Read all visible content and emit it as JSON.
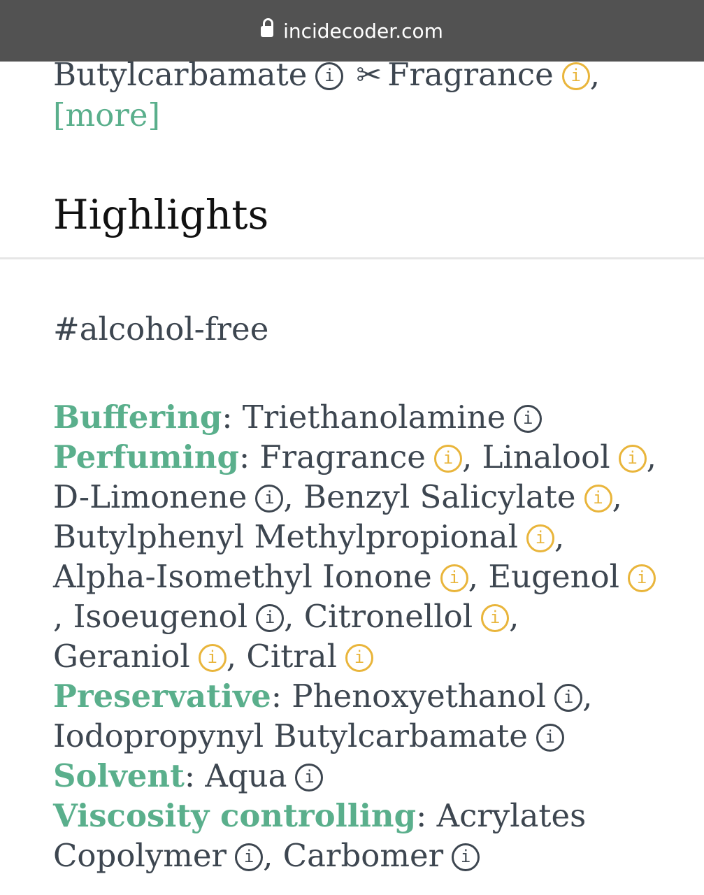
{
  "browser": {
    "url": "incidecoder.com"
  },
  "ingredients_tail": {
    "items": [
      {
        "name": "Butylcarbamate",
        "rating": "neutral"
      },
      {
        "name": "Fragrance",
        "rating": "warning"
      }
    ],
    "more_link": "[more]"
  },
  "highlights": {
    "title": "Highlights",
    "tag": "#alcohol-free"
  },
  "functions": [
    {
      "category": "Buffering",
      "ingredients": [
        {
          "name": "Triethanolamine",
          "rating": "neutral"
        }
      ]
    },
    {
      "category": "Perfuming",
      "ingredients": [
        {
          "name": "Fragrance",
          "rating": "warning"
        },
        {
          "name": "Linalool",
          "rating": "warning"
        },
        {
          "name": "D-Limonene",
          "rating": "neutral"
        },
        {
          "name": "Benzyl Salicylate",
          "rating": "warning"
        },
        {
          "name": "Butylphenyl Methylpropional",
          "rating": "warning"
        },
        {
          "name": "Alpha-Isomethyl Ionone",
          "rating": "warning"
        },
        {
          "name": "Eugenol",
          "rating": "warning"
        },
        {
          "name": "Isoeugenol",
          "rating": "neutral"
        },
        {
          "name": "Citronellol",
          "rating": "warning"
        },
        {
          "name": "Geraniol",
          "rating": "warning"
        },
        {
          "name": "Citral",
          "rating": "warning"
        }
      ]
    },
    {
      "category": "Preservative",
      "ingredients": [
        {
          "name": "Phenoxyethanol",
          "rating": "neutral"
        },
        {
          "name": "Iodopropynyl Butylcarbamate",
          "rating": "neutral"
        }
      ]
    },
    {
      "category": "Solvent",
      "ingredients": [
        {
          "name": "Aqua",
          "rating": "neutral"
        }
      ]
    },
    {
      "category": "Viscosity controlling",
      "ingredients": [
        {
          "name": "Acrylates Copolymer",
          "rating": "neutral"
        },
        {
          "name": "Carbomer",
          "rating": "neutral"
        }
      ]
    }
  ],
  "colors": {
    "accent_green": "#5aaf8c",
    "warning_yellow": "#e9b53b",
    "text_dark": "#3d4650",
    "urlbar_bg": "#525252"
  },
  "icons": {
    "info": "info-icon",
    "lock": "lock-icon",
    "scissors": "scissors-icon"
  }
}
